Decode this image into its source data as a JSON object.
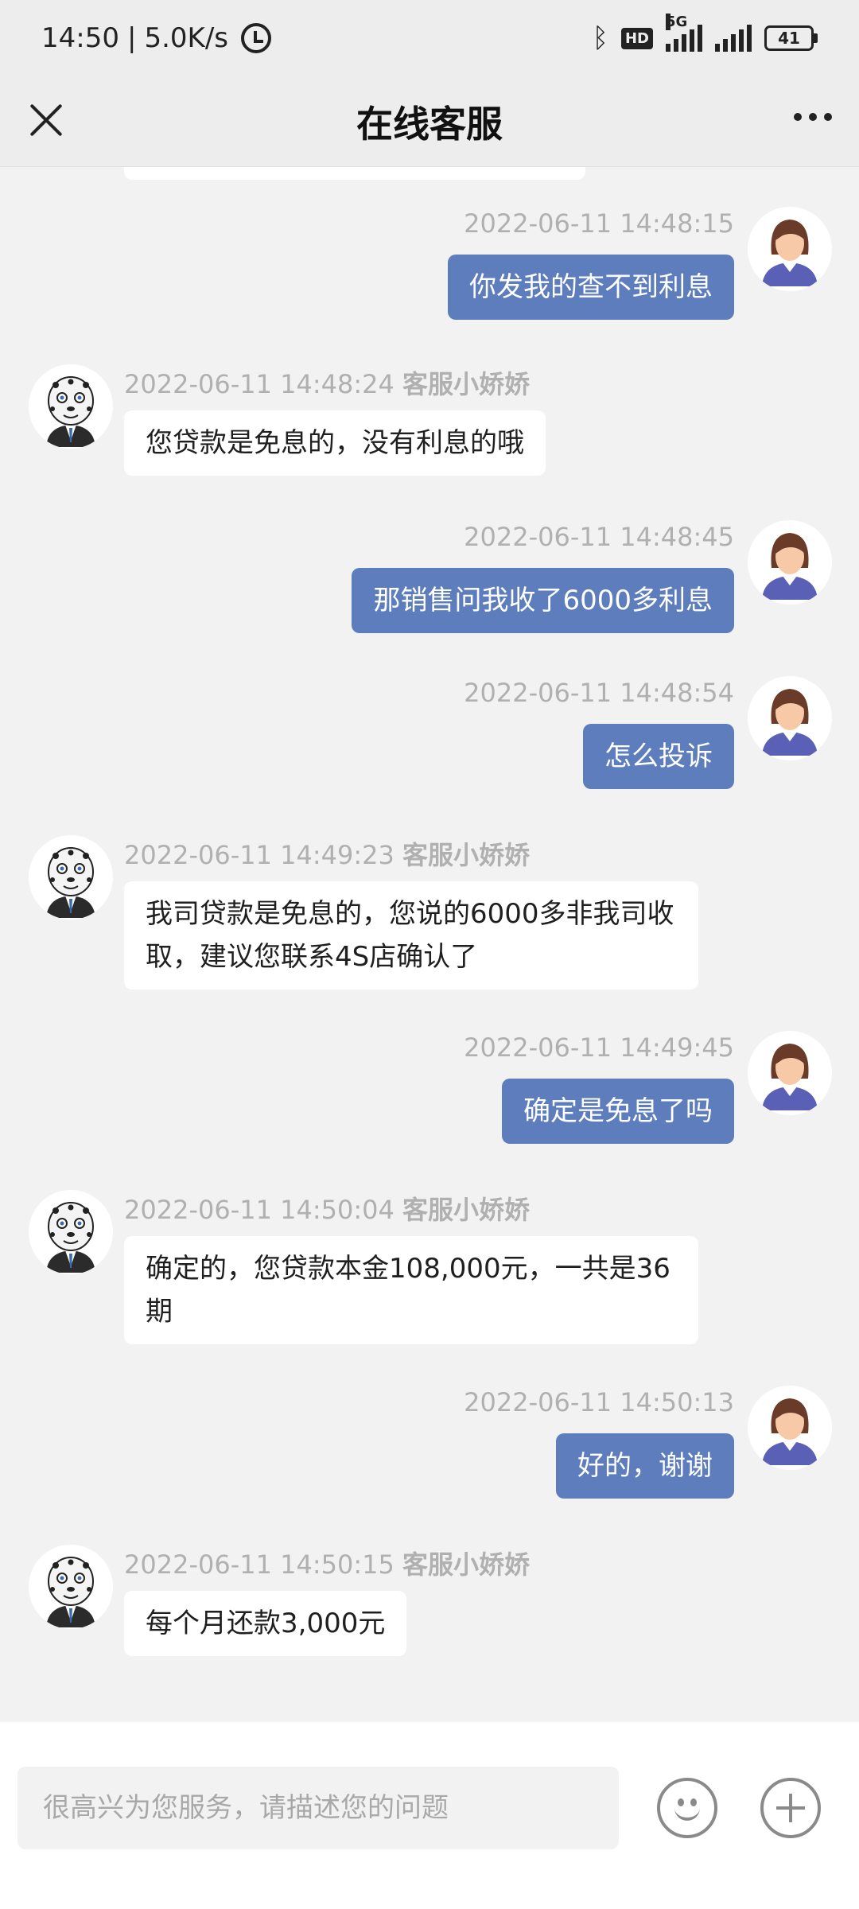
{
  "status_bar": {
    "time": "14:50",
    "separator": "|",
    "speed": "5.0K/s",
    "hd_label": "HD",
    "network_label": "5G",
    "battery": "41"
  },
  "header": {
    "title": "在线客服"
  },
  "messages": [
    {
      "side": "user",
      "timestamp": "2022-06-11 14:48:15",
      "text": "你发我的查不到利息"
    },
    {
      "side": "agent",
      "timestamp": "2022-06-11 14:48:24",
      "sender": "客服小娇娇",
      "text": "您贷款是免息的，没有利息的哦"
    },
    {
      "side": "user",
      "timestamp": "2022-06-11 14:48:45",
      "text": "那销售问我收了6000多利息"
    },
    {
      "side": "user",
      "timestamp": "2022-06-11 14:48:54",
      "text": "怎么投诉"
    },
    {
      "side": "agent",
      "timestamp": "2022-06-11 14:49:23",
      "sender": "客服小娇娇",
      "text": "我司贷款是免息的，您说的6000多非我司收取，建议您联系4S店确认了"
    },
    {
      "side": "user",
      "timestamp": "2022-06-11 14:49:45",
      "text": "确定是免息了吗"
    },
    {
      "side": "agent",
      "timestamp": "2022-06-11 14:50:04",
      "sender": "客服小娇娇",
      "text": "确定的，您贷款本金108,000元，一共是36期"
    },
    {
      "side": "user",
      "timestamp": "2022-06-11 14:50:13",
      "text": "好的，谢谢"
    },
    {
      "side": "agent",
      "timestamp": "2022-06-11 14:50:15",
      "sender": "客服小娇娇",
      "text": "每个月还款3,000元"
    }
  ],
  "input": {
    "placeholder": "很高兴为您服务，请描述您的问题",
    "value": ""
  },
  "icons": {
    "close": "close-icon",
    "more": "more-icon",
    "emoji": "emoji-icon",
    "add": "plus-icon",
    "user_avatar": "user-avatar",
    "agent_avatar": "agent-avatar"
  },
  "colors": {
    "user_bubble": "#5d7dbd",
    "agent_bubble": "#ffffff",
    "background": "#f2f2f2",
    "header": "#ededed"
  }
}
